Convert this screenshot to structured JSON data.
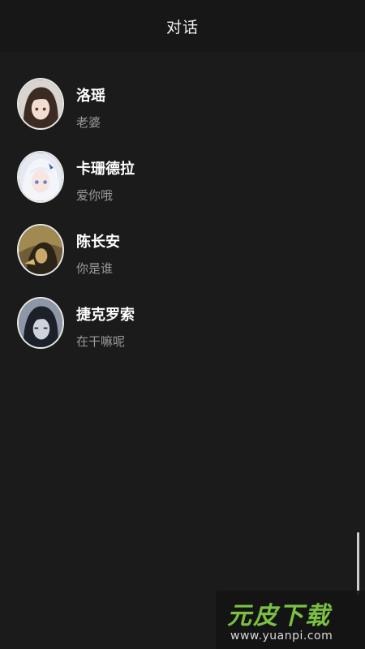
{
  "header": {
    "title": "对话"
  },
  "conversations": [
    {
      "name": "洛瑶",
      "preview": "老婆",
      "avatar_icon": "anime-girl-brown-hair-avatar",
      "avatar_colors": [
        "#d7d2cc",
        "#3a2a22"
      ]
    },
    {
      "name": "卡珊德拉",
      "preview": "爱你哦",
      "avatar_icon": "anime-girl-white-hair-avatar",
      "avatar_colors": [
        "#dfe6f2",
        "#6a8fd8"
      ]
    },
    {
      "name": "陈长安",
      "preview": "你是谁",
      "avatar_icon": "anime-boy-golden-armor-avatar",
      "avatar_colors": [
        "#8a7445",
        "#2b2417"
      ]
    },
    {
      "name": "捷克罗索",
      "preview": "在干嘛呢",
      "avatar_icon": "anime-boy-dark-hair-avatar",
      "avatar_colors": [
        "#8c96a6",
        "#1b1f28"
      ]
    }
  ],
  "watermark": {
    "logo": "元皮下载",
    "url": "www.yuanpi.com"
  },
  "colors": {
    "background": "#1b1b1b",
    "name": "#ffffff",
    "preview": "#9a9a9a",
    "watermark_green": "#7bc043"
  }
}
